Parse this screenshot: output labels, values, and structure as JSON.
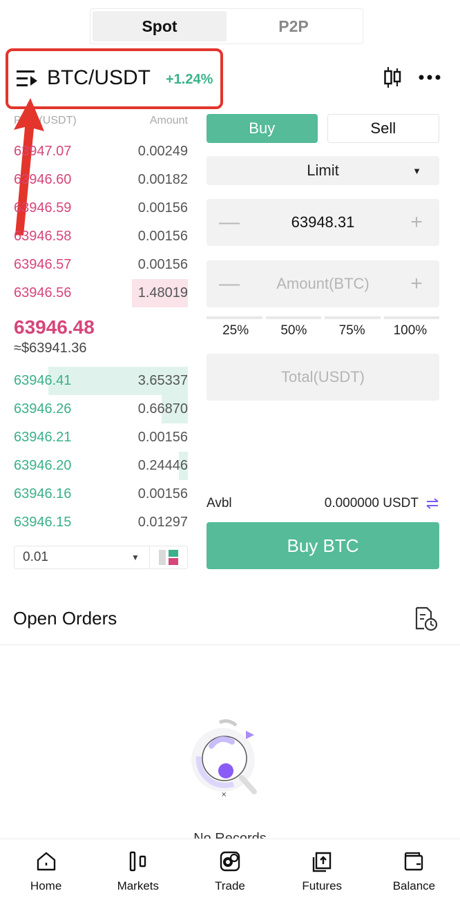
{
  "tabs": {
    "spot": "Spot",
    "p2p": "P2P"
  },
  "pair": {
    "name": "BTC/USDT",
    "change": "+1.24%"
  },
  "orderbook": {
    "head_price": "Price(USDT)",
    "head_amount": "Amount",
    "asks": [
      {
        "price": "63947.07",
        "amount": "0.00249",
        "depth": 0
      },
      {
        "price": "63946.60",
        "amount": "0.00182",
        "depth": 0
      },
      {
        "price": "63946.59",
        "amount": "0.00156",
        "depth": 0
      },
      {
        "price": "63946.58",
        "amount": "0.00156",
        "depth": 0
      },
      {
        "price": "63946.57",
        "amount": "0.00156",
        "depth": 0
      },
      {
        "price": "63946.56",
        "amount": "1.48019",
        "depth": 0.32
      }
    ],
    "last_price": "63946.48",
    "last_usd": "≈$63941.36",
    "bids": [
      {
        "price": "63946.41",
        "amount": "3.65337",
        "depth": 0.8
      },
      {
        "price": "63946.26",
        "amount": "0.66870",
        "depth": 0.15
      },
      {
        "price": "63946.21",
        "amount": "0.00156",
        "depth": 0
      },
      {
        "price": "63946.20",
        "amount": "0.24446",
        "depth": 0.05
      },
      {
        "price": "63946.16",
        "amount": "0.00156",
        "depth": 0
      },
      {
        "price": "63946.15",
        "amount": "0.01297",
        "depth": 0
      }
    ],
    "precision": "0.01"
  },
  "trade": {
    "buy_label": "Buy",
    "sell_label": "Sell",
    "order_type": "Limit",
    "price_value": "63948.31",
    "amount_placeholder": "Amount(BTC)",
    "percents": [
      "25%",
      "50%",
      "75%",
      "100%"
    ],
    "total_placeholder": "Total(USDT)",
    "avbl_label": "Avbl",
    "avbl_value": "0.000000 USDT",
    "buy_button": "Buy BTC"
  },
  "open_orders": {
    "title": "Open Orders",
    "empty_text": "No Records"
  },
  "nav": [
    {
      "label": "Home",
      "icon": "home-icon"
    },
    {
      "label": "Markets",
      "icon": "markets-icon"
    },
    {
      "label": "Trade",
      "icon": "trade-icon"
    },
    {
      "label": "Futures",
      "icon": "futures-icon"
    },
    {
      "label": "Balance",
      "icon": "wallet-icon"
    }
  ],
  "colors": {
    "buy": "#55bb98",
    "ask": "#d6467a",
    "bid": "#3bb08a",
    "annotation": "#e3352c"
  }
}
